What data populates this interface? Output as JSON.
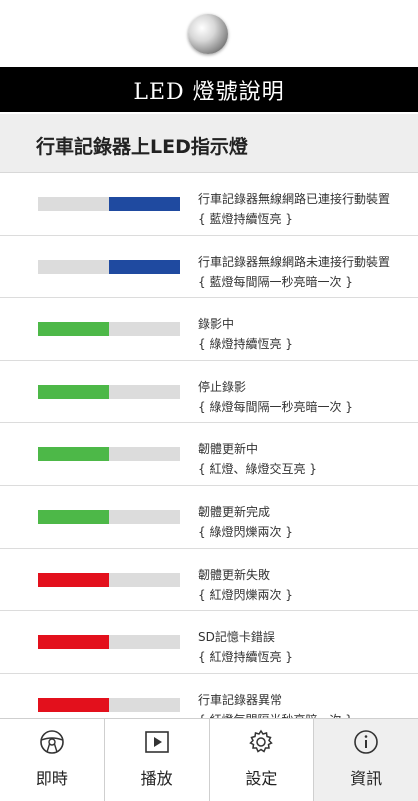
{
  "header": {
    "title": "LED 燈號說明"
  },
  "section": {
    "title": "行車記錄器上LED指示燈"
  },
  "colors": {
    "blue": "#1f4aa0",
    "green": "#4db848",
    "red": "#e3101c",
    "off": "#dcdcdc"
  },
  "items": [
    {
      "led_left": "off",
      "led_right": "blue",
      "title": "行車記錄器無線網路已連接行動裝置",
      "detail": "{ 藍燈持續恆亮 }"
    },
    {
      "led_left": "off",
      "led_right": "blue",
      "title": "行車記錄器無線網路未連接行動裝置",
      "detail": "{ 藍燈每間隔一秒亮暗一次 }"
    },
    {
      "led_left": "green",
      "led_right": "off",
      "title": "錄影中",
      "detail": "{ 綠燈持續恆亮 }"
    },
    {
      "led_left": "green",
      "led_right": "off",
      "title": "停止錄影",
      "detail": "{ 綠燈每間隔一秒亮暗一次 }"
    },
    {
      "led_left": "green",
      "led_right": "off",
      "title": "韌體更新中",
      "detail": "{ 紅燈、綠燈交互亮 }"
    },
    {
      "led_left": "green",
      "led_right": "off",
      "title": "韌體更新完成",
      "detail": "{ 綠燈閃爍兩次 }"
    },
    {
      "led_left": "red",
      "led_right": "off",
      "title": "韌體更新失敗",
      "detail": "{ 紅燈閃爍兩次 }"
    },
    {
      "led_left": "red",
      "led_right": "off",
      "title": "SD記憶卡錯誤",
      "detail": "{ 紅燈持續恆亮 }"
    },
    {
      "led_left": "red",
      "led_right": "off",
      "title": "行車記錄器異常",
      "detail": "{ 紅燈每間隔半秒亮暗一次 }"
    }
  ],
  "tabs": [
    {
      "label": "即時",
      "icon": "steering-wheel-icon"
    },
    {
      "label": "播放",
      "icon": "play-icon"
    },
    {
      "label": "設定",
      "icon": "gear-icon"
    },
    {
      "label": "資訊",
      "icon": "info-icon",
      "active": true
    }
  ]
}
